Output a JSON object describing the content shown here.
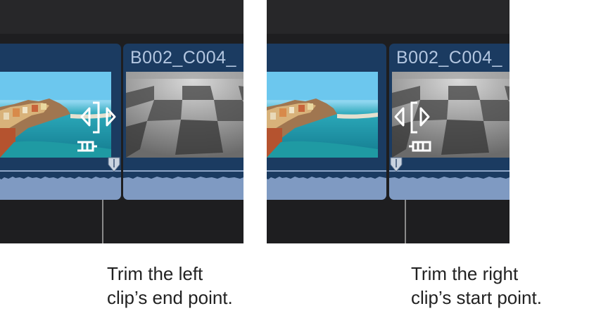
{
  "left_panel": {
    "next_clip_name": "B002_C004_",
    "callout_line1": "Trim the left",
    "callout_line2": "clip’s end point."
  },
  "right_panel": {
    "clip_name": "B002_C004_",
    "callout_line1": "Trim the right",
    "callout_line2": "clip’s start point."
  },
  "icons": {
    "trim_end": "trim-end-cursor-icon",
    "trim_start": "trim-start-cursor-icon",
    "marker": "marker-icon"
  },
  "colors": {
    "timeline_bg": "#1e1e20",
    "clip_blue": "#1b3b61",
    "clip_title": "#b3c6e0",
    "waveform": "#7f9ac2",
    "leader_line": "#8a8a8a"
  }
}
